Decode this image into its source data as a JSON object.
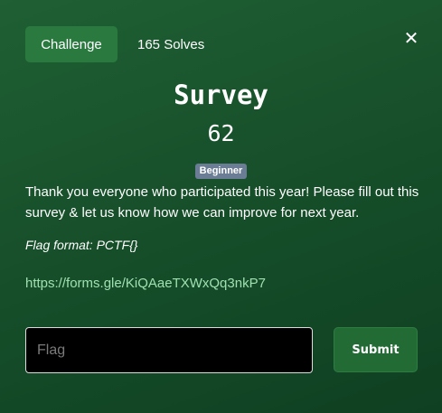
{
  "header": {
    "tab_label": "Challenge",
    "solves": "165 Solves",
    "close_symbol": "✕"
  },
  "challenge": {
    "name": "Survey",
    "points": "62",
    "difficulty": "Beginner",
    "description": "Thank you everyone who participated this year! Please fill out this survey & let us know how we can improve for next year.",
    "flag_format": "Flag format: PCTF{}",
    "link": "https://forms.gle/KiQAaeTXWxQq3nkP7"
  },
  "form": {
    "flag_placeholder": "Flag",
    "flag_value": "",
    "submit_label": "Submit"
  },
  "colors": {
    "background": "#1a552e",
    "accent_button": "#2a7a3f",
    "badge": "#6b7d95",
    "link": "#9fe0b0"
  },
  "icons": {
    "close": "close-icon"
  }
}
